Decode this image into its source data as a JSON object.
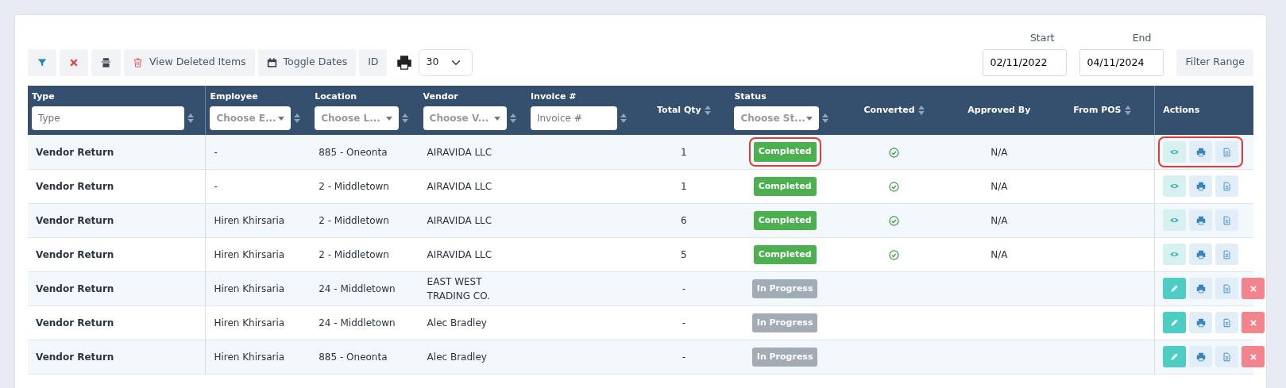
{
  "toolbar": {
    "buttons": [
      {
        "kind": "filter"
      },
      {
        "kind": "clear"
      },
      {
        "kind": "incognito"
      },
      {
        "kind": "trash",
        "label": "View Deleted Items"
      },
      {
        "kind": "calendar",
        "label": "Toggle Dates"
      },
      {
        "kind": "text",
        "label": "ID"
      }
    ],
    "page_size": "30"
  },
  "date_range": {
    "start_label": "Start",
    "start": "02/11/2022",
    "end_label": "End",
    "end": "04/11/2024",
    "button": "Filter Range"
  },
  "table": {
    "columns": [
      {
        "label": "Type",
        "filter": {
          "kind": "text",
          "placeholder": "Type"
        },
        "sortable": true
      },
      {
        "label": "Employee",
        "filter": {
          "kind": "select",
          "placeholder": "Choose E..."
        },
        "sortable": true
      },
      {
        "label": "Location",
        "filter": {
          "kind": "select",
          "placeholder": "Choose L..."
        },
        "sortable": true
      },
      {
        "label": "Vendor",
        "filter": {
          "kind": "select",
          "placeholder": "Choose V..."
        },
        "sortable": true
      },
      {
        "label": "Invoice #",
        "filter": {
          "kind": "text",
          "placeholder": "Invoice #"
        },
        "sortable": true
      },
      {
        "label": "Total Qty",
        "sortable": true
      },
      {
        "label": "Status",
        "filter": {
          "kind": "select",
          "placeholder": "Choose St..."
        },
        "sortable": true
      },
      {
        "label": "Converted",
        "sortable": true
      },
      {
        "label": "Approved By",
        "sortable": false
      },
      {
        "label": "From POS",
        "sortable": true
      },
      {
        "label": "Actions",
        "sortable": false
      }
    ],
    "rows": [
      {
        "type": "Vendor Return",
        "employee": "-",
        "location": "885 - Oneonta",
        "vendor": "AIRAVIDA LLC",
        "total_qty": "1",
        "status": {
          "label": "Completed",
          "kind": "completed"
        },
        "converted": true,
        "approved_by": "N/A",
        "actions": [
          {
            "kind": "view"
          },
          {
            "kind": "print"
          },
          {
            "kind": "document"
          }
        ],
        "highlighted": true
      },
      {
        "type": "Vendor Return",
        "employee": "-",
        "location": "2 - Middletown",
        "vendor": "AIRAVIDA LLC",
        "total_qty": "1",
        "status": {
          "label": "Completed",
          "kind": "completed"
        },
        "converted": true,
        "approved_by": "N/A",
        "actions": [
          {
            "kind": "view"
          },
          {
            "kind": "print"
          },
          {
            "kind": "document"
          }
        ],
        "highlighted": false
      },
      {
        "type": "Vendor Return",
        "employee": "Hiren Khirsaria",
        "location": "2 - Middletown",
        "vendor": "AIRAVIDA LLC",
        "total_qty": "6",
        "status": {
          "label": "Completed",
          "kind": "completed"
        },
        "converted": true,
        "approved_by": "N/A",
        "actions": [
          {
            "kind": "view"
          },
          {
            "kind": "print"
          },
          {
            "kind": "document"
          }
        ],
        "highlighted": false
      },
      {
        "type": "Vendor Return",
        "employee": "Hiren Khirsaria",
        "location": "2 - Middletown",
        "vendor": "AIRAVIDA LLC",
        "total_qty": "5",
        "status": {
          "label": "Completed",
          "kind": "completed"
        },
        "converted": true,
        "approved_by": "N/A",
        "actions": [
          {
            "kind": "view"
          },
          {
            "kind": "print"
          },
          {
            "kind": "document"
          }
        ],
        "highlighted": false
      },
      {
        "type": "Vendor Return",
        "employee": "Hiren Khirsaria",
        "location": "24 - Middletown",
        "vendor": "EAST WEST TRADING CO.",
        "total_qty": "-",
        "status": {
          "label": "In Progress",
          "kind": "in_progress"
        },
        "converted": false,
        "actions": [
          {
            "kind": "edit"
          },
          {
            "kind": "print"
          },
          {
            "kind": "document"
          },
          {
            "kind": "delete"
          }
        ],
        "highlighted": false
      },
      {
        "type": "Vendor Return",
        "employee": "Hiren Khirsaria",
        "location": "24 - Middletown",
        "vendor": "Alec Bradley",
        "total_qty": "-",
        "status": {
          "label": "In Progress",
          "kind": "in_progress"
        },
        "converted": false,
        "actions": [
          {
            "kind": "edit"
          },
          {
            "kind": "print"
          },
          {
            "kind": "document"
          },
          {
            "kind": "delete"
          }
        ],
        "highlighted": false
      },
      {
        "type": "Vendor Return",
        "employee": "Hiren Khirsaria",
        "location": "885 - Oneonta",
        "vendor": "Alec Bradley",
        "total_qty": "-",
        "status": {
          "label": "In Progress",
          "kind": "in_progress"
        },
        "converted": false,
        "actions": [
          {
            "kind": "edit"
          },
          {
            "kind": "print"
          },
          {
            "kind": "document"
          },
          {
            "kind": "delete"
          }
        ],
        "highlighted": false
      }
    ]
  }
}
